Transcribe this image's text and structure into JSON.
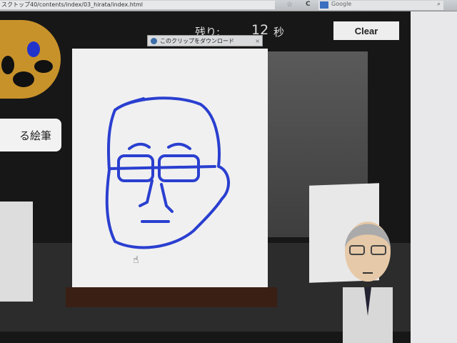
{
  "browser": {
    "url": "スクトップ40/contents/index/03_hirata/index.html",
    "search_placeholder": "Google"
  },
  "game": {
    "timer_label": "残り:",
    "timer_value": "12",
    "timer_unit": "秒",
    "clear_label": "Clear",
    "brush_button_label": "る絵筆"
  },
  "clip_toolbar": {
    "label": "このクリップをダウンロード",
    "close": "×"
  },
  "colors": {
    "stroke": "#2a3fd0",
    "palette": "#c8922a"
  }
}
